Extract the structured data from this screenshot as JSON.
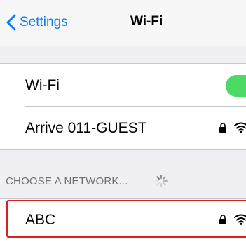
{
  "nav": {
    "back_label": "Settings",
    "title": "Wi-Fi"
  },
  "wifi_toggle": {
    "label": "Wi-Fi",
    "enabled": true,
    "on_color": "#4cd964"
  },
  "connected_network": {
    "name": "Arrive 011-GUEST",
    "secured": true,
    "icons": [
      "lock-icon",
      "wifi-icon"
    ]
  },
  "section": {
    "header": "CHOOSE A NETWORK...",
    "loading_icon": "spinner-icon"
  },
  "networks": [
    {
      "name": "ABC",
      "secured": true,
      "icons": [
        "lock-icon",
        "wifi-icon"
      ]
    }
  ],
  "colors": {
    "accent": "#0a7aff",
    "highlight": "#d9211f",
    "background": "#efeff4",
    "separator": "#c8c7cc"
  }
}
